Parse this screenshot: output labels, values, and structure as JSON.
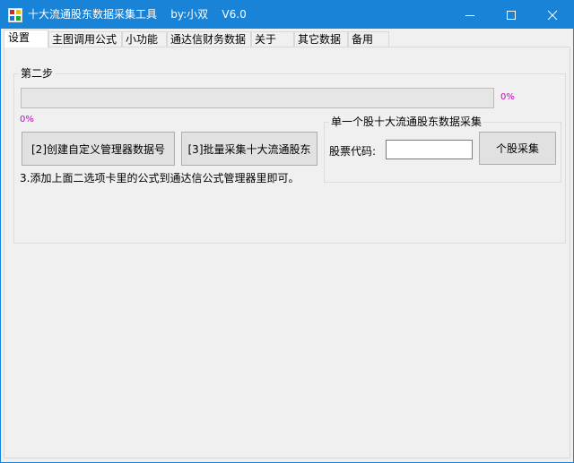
{
  "window": {
    "title": "十大流通股东数据采集工具    by:小双    V6.0"
  },
  "titlebar_icons": {
    "app": "app-icon",
    "minimize": "minimize-icon",
    "maximize": "maximize-icon",
    "close": "close-icon"
  },
  "tabs": [
    {
      "label": "设置",
      "active": true
    },
    {
      "label": "主图调用公式"
    },
    {
      "label": "小功能"
    },
    {
      "label": "通达信财务数据"
    },
    {
      "label": "关于"
    },
    {
      "label": "其它数据"
    },
    {
      "label": "备用"
    }
  ],
  "step_group": {
    "legend": "第二步",
    "main_progress": {
      "value": 0,
      "label": "0%"
    },
    "secondary_progress_label": "0%",
    "create_button": "[2]创建自定义管理器数据号",
    "batch_button": "[3]批量采集十大流通股东",
    "instruction": "3.添加上面二选项卡里的公式到通达信公式管理器里即可。"
  },
  "single_group": {
    "legend": "单一个股十大流通股东数据采集",
    "stock_code_label": "股票代码:",
    "stock_code_value": "",
    "collect_button": "个股采集"
  },
  "colors": {
    "titlebar": "#1883d7",
    "percent_text": "#cc00cc"
  }
}
